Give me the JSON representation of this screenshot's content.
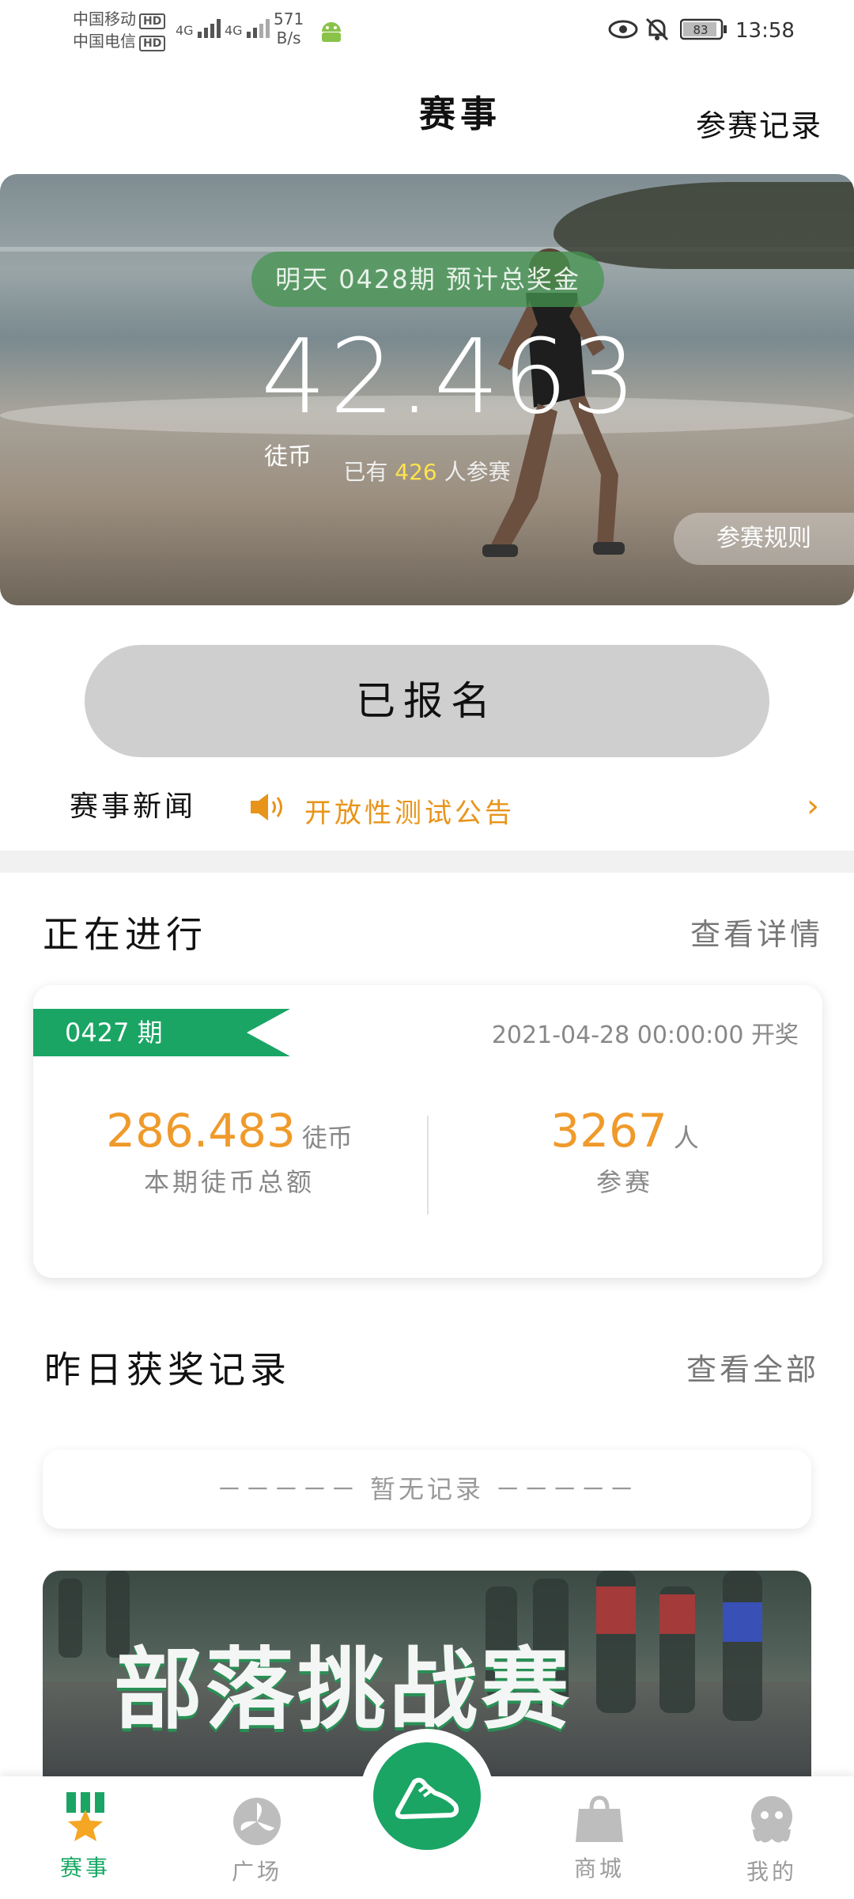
{
  "status_bar": {
    "carrier1": "中国移动",
    "carrier2": "中国电信",
    "hd": "HD",
    "signal": "4G",
    "net_speed_value": "571",
    "net_speed_unit": "B/s",
    "battery": "83",
    "time": "13:58"
  },
  "header": {
    "title": "赛事",
    "record_link": "参赛记录"
  },
  "banner": {
    "period_pill": "明天 0428期 预计总奖金",
    "prize_amount": "42.463",
    "prize_unit": "徒币",
    "participants_prefix": "已有",
    "participants_count": "426",
    "participants_suffix": "人参赛",
    "rules_button": "参赛规则"
  },
  "register_button": "已报名",
  "news": {
    "label": "赛事新闻",
    "headline": "开放性测试公告"
  },
  "ongoing": {
    "title": "正在进行",
    "link": "查看详情",
    "period": "0427 期",
    "draw_time": "2021-04-28 00:00:00 开奖",
    "total_amount": "286.483",
    "total_unit": "徒币",
    "total_label": "本期徒币总额",
    "participants": "3267",
    "participants_unit": "人",
    "participants_label": "参赛"
  },
  "winners": {
    "title": "昨日获奖记录",
    "link": "查看全部",
    "empty_text": "－－－－－ 暂无记录 －－－－－"
  },
  "promo": {
    "title": "部落挑战赛"
  },
  "bottom_nav": {
    "items": [
      {
        "label": "赛事",
        "icon": "medal-star-icon"
      },
      {
        "label": "广场",
        "icon": "pinwheel-icon"
      },
      {
        "label": "",
        "icon": "running-shoe-icon"
      },
      {
        "label": "商城",
        "icon": "shopping-bag-icon"
      },
      {
        "label": "我的",
        "icon": "octopus-avatar-icon"
      }
    ],
    "active_color": "#19a865"
  },
  "colors": {
    "accent_green": "#1aa565",
    "accent_orange": "#ef9a2b",
    "highlight_yellow": "#ffe34d"
  }
}
